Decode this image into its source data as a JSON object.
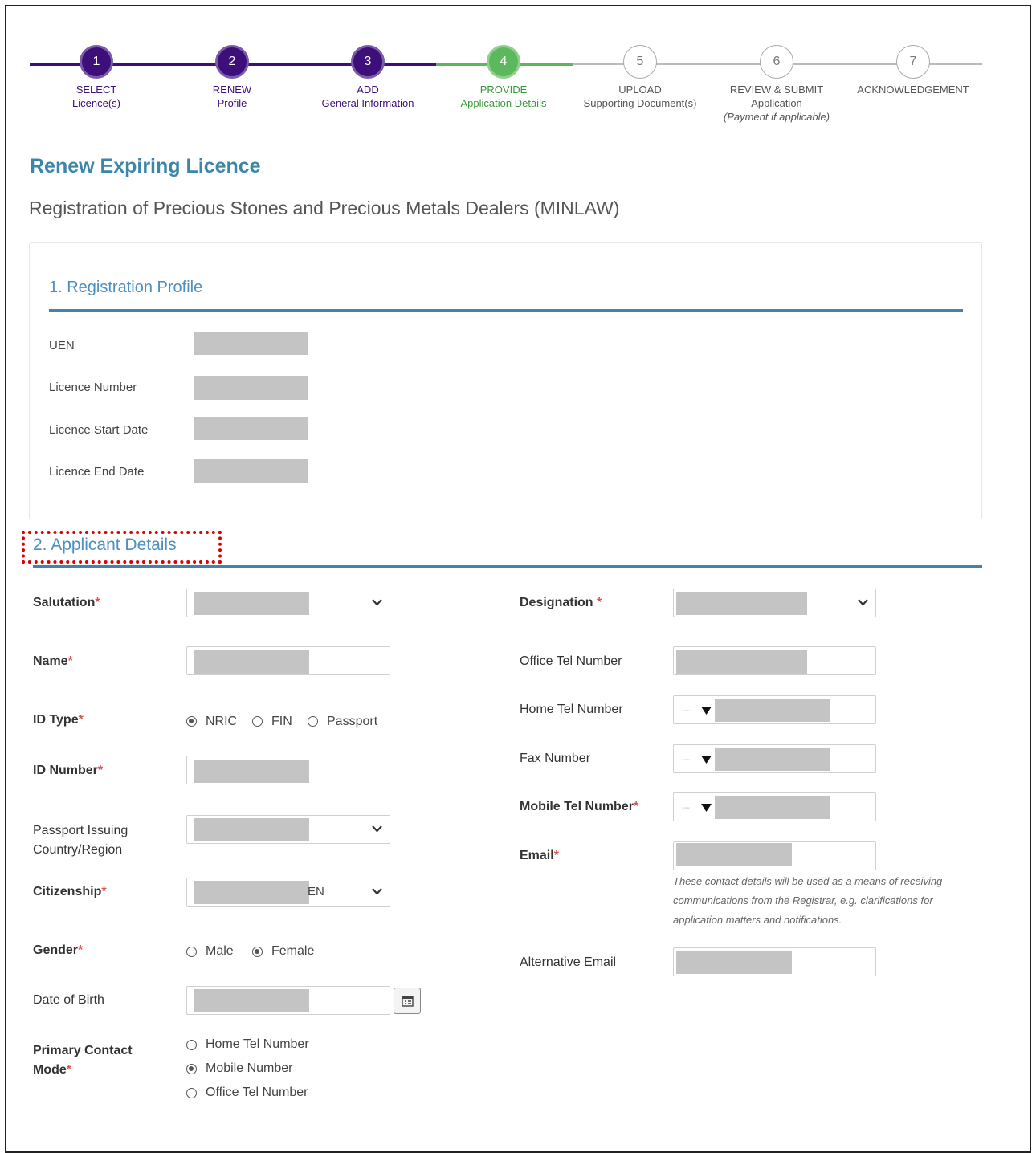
{
  "stepper": {
    "steps": [
      {
        "num": "1",
        "line1": "SELECT",
        "line2": "Licence(s)",
        "line3": "",
        "state": "done"
      },
      {
        "num": "2",
        "line1": "RENEW",
        "line2": "Profile",
        "line3": "",
        "state": "done"
      },
      {
        "num": "3",
        "line1": "ADD",
        "line2": "General Information",
        "line3": "",
        "state": "done"
      },
      {
        "num": "4",
        "line1": "PROVIDE",
        "line2": "Application Details",
        "line3": "",
        "state": "current"
      },
      {
        "num": "5",
        "line1": "UPLOAD",
        "line2": "Supporting Document(s)",
        "line3": "",
        "state": "todo"
      },
      {
        "num": "6",
        "line1": "REVIEW & SUBMIT",
        "line2": "Application",
        "line3": "(Payment if applicable)",
        "state": "todo"
      },
      {
        "num": "7",
        "line1": "ACKNOWLEDGEMENT",
        "line2": "",
        "line3": "",
        "state": "todo"
      }
    ]
  },
  "page": {
    "title": "Renew Expiring Licence",
    "subtitle": "Registration of Precious Stones and Precious Metals Dealers (MINLAW)"
  },
  "registration_profile": {
    "heading": "1. Registration Profile",
    "fields": [
      "UEN",
      "Licence Number",
      "Licence Start Date",
      "Licence End Date"
    ]
  },
  "applicant": {
    "heading": "2. Applicant Details",
    "required_mark": "*",
    "salutation": "Salutation",
    "name": "Name",
    "id_type": "ID Type",
    "id_type_options": [
      "NRIC",
      "FIN",
      "Passport"
    ],
    "id_number": "ID Number",
    "passport_country_line1": "Passport Issuing",
    "passport_country_line2": "Country/Region",
    "citizenship": "Citizenship",
    "citizenship_value_tail": "EN",
    "gender": "Gender",
    "gender_options": [
      "Male",
      "Female"
    ],
    "dob": "Date of Birth",
    "primary_contact_line1": "Primary Contact",
    "primary_contact_line2": "Mode",
    "primary_contact_options": [
      "Home Tel Number",
      "Mobile Number",
      "Office Tel Number"
    ],
    "designation": "Designation",
    "office_tel": "Office Tel Number",
    "home_tel": "Home Tel Number",
    "fax": "Fax Number",
    "mobile_tel": "Mobile Tel Number",
    "email": "Email",
    "contact_note": "These contact details will be used as a means of receiving communications from the Registrar, e.g. clarifications for application matters and notifications.",
    "alt_email": "Alternative Email",
    "code_placeholder": "---"
  },
  "colors": {
    "done": "#3d0f7a",
    "current": "#5cb85c",
    "accent": "#3c86a8",
    "required": "#d9534f"
  },
  "icons": [
    "chevron-down-icon",
    "caret-down-icon",
    "calendar-icon"
  ]
}
